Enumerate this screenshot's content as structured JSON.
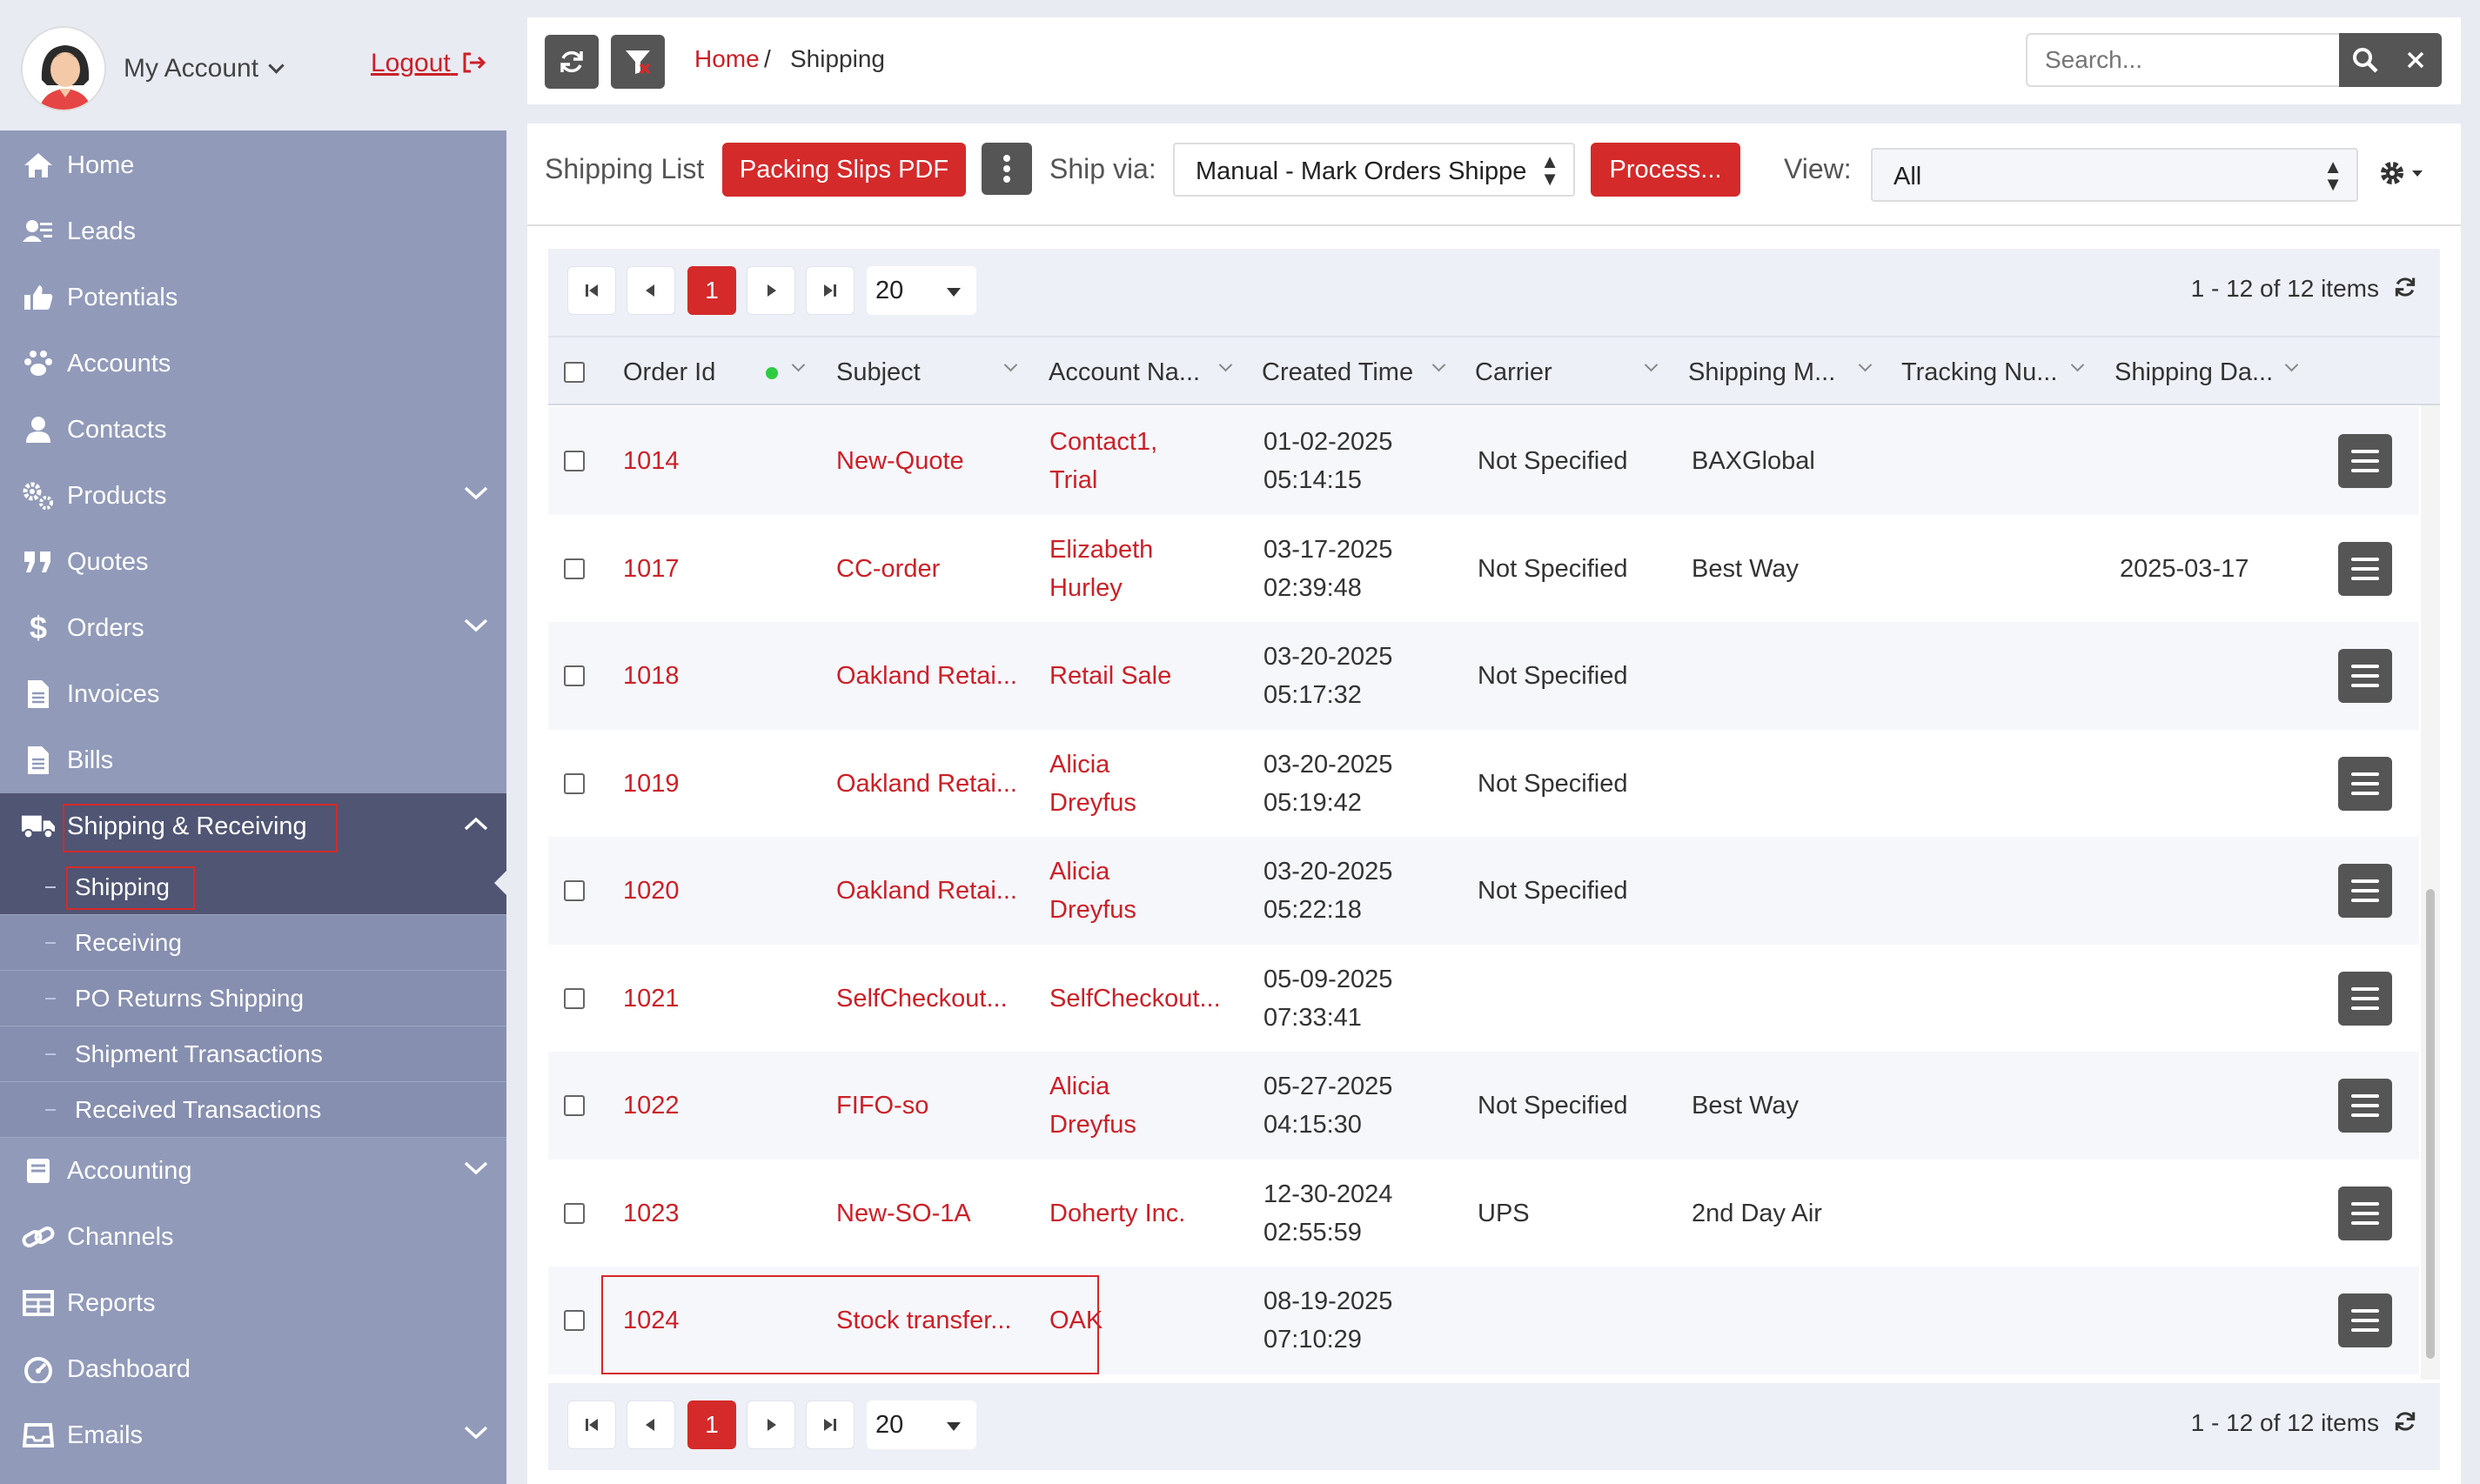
{
  "account": {
    "name": "My Account",
    "logout": "Logout"
  },
  "sidebar": {
    "items": [
      {
        "label": "Home",
        "icon": "home-icon"
      },
      {
        "label": "Leads",
        "icon": "leads-icon"
      },
      {
        "label": "Potentials",
        "icon": "thumbs-up-icon"
      },
      {
        "label": "Accounts",
        "icon": "paw-icon"
      },
      {
        "label": "Contacts",
        "icon": "user-icon"
      },
      {
        "label": "Products",
        "icon": "gears-icon"
      },
      {
        "label": "Quotes",
        "icon": "quote-icon"
      },
      {
        "label": "Orders",
        "icon": "dollar-icon"
      },
      {
        "label": "Invoices",
        "icon": "document-icon"
      },
      {
        "label": "Bills",
        "icon": "document-icon"
      },
      {
        "label": "Shipping & Receiving",
        "icon": "truck-icon"
      },
      {
        "label": "Accounting",
        "icon": "ledger-icon"
      },
      {
        "label": "Channels",
        "icon": "link-icon"
      },
      {
        "label": "Reports",
        "icon": "table-icon"
      },
      {
        "label": "Dashboard",
        "icon": "dashboard-icon"
      },
      {
        "label": "Emails",
        "icon": "inbox-icon"
      }
    ],
    "sub_items": [
      {
        "label": "Shipping"
      },
      {
        "label": "Receiving"
      },
      {
        "label": "PO Returns Shipping"
      },
      {
        "label": "Shipment Transactions"
      },
      {
        "label": "Received Transactions"
      }
    ]
  },
  "breadcrumb": {
    "home": "Home",
    "separator": "/",
    "current": "Shipping"
  },
  "search": {
    "placeholder": "Search..."
  },
  "listbar": {
    "title": "Shipping List",
    "packing_slips": "Packing Slips PDF",
    "ship_via_label": "Ship via:",
    "ship_via_value": "Manual - Mark Orders Shippe",
    "process": "Process...",
    "view_label": "View:",
    "view_value": "All"
  },
  "pager": {
    "current_page": "1",
    "page_size": "20",
    "info": "1 - 12 of 12 items"
  },
  "columns": [
    "Order Id",
    "Subject",
    "Account Na...",
    "Created Time",
    "Carrier",
    "Shipping M...",
    "Tracking Nu...",
    "Shipping Da..."
  ],
  "rows": [
    {
      "order_id": "1014",
      "subject": "New-Quote",
      "account": [
        "Contact1,",
        "Trial"
      ],
      "created": [
        "01-02-2025",
        "05:14:15"
      ],
      "carrier": "Not Specified",
      "method": "BAXGlobal",
      "tracking": "",
      "ship_date": ""
    },
    {
      "order_id": "1017",
      "subject": "CC-order",
      "account": [
        "Elizabeth",
        "Hurley"
      ],
      "created": [
        "03-17-2025",
        "02:39:48"
      ],
      "carrier": "Not Specified",
      "method": "Best Way",
      "tracking": "",
      "ship_date": "2025-03-17"
    },
    {
      "order_id": "1018",
      "subject": "Oakland Retai...",
      "account": [
        "Retail Sale",
        ""
      ],
      "created": [
        "03-20-2025",
        "05:17:32"
      ],
      "carrier": "Not Specified",
      "method": "",
      "tracking": "",
      "ship_date": ""
    },
    {
      "order_id": "1019",
      "subject": "Oakland Retai...",
      "account": [
        "Alicia",
        "Dreyfus"
      ],
      "created": [
        "03-20-2025",
        "05:19:42"
      ],
      "carrier": "Not Specified",
      "method": "",
      "tracking": "",
      "ship_date": ""
    },
    {
      "order_id": "1020",
      "subject": "Oakland Retai...",
      "account": [
        "Alicia",
        "Dreyfus"
      ],
      "created": [
        "03-20-2025",
        "05:22:18"
      ],
      "carrier": "Not Specified",
      "method": "",
      "tracking": "",
      "ship_date": ""
    },
    {
      "order_id": "1021",
      "subject": "SelfCheckout...",
      "account": [
        "SelfCheckout...",
        ""
      ],
      "created": [
        "05-09-2025",
        "07:33:41"
      ],
      "carrier": "",
      "method": "",
      "tracking": "",
      "ship_date": ""
    },
    {
      "order_id": "1022",
      "subject": "FIFO-so",
      "account": [
        "Alicia",
        "Dreyfus"
      ],
      "created": [
        "05-27-2025",
        "04:15:30"
      ],
      "carrier": "Not Specified",
      "method": "Best Way",
      "tracking": "",
      "ship_date": ""
    },
    {
      "order_id": "1023",
      "subject": "New-SO-1A",
      "account": [
        "Doherty Inc.",
        ""
      ],
      "created": [
        "12-30-2024",
        "02:55:59"
      ],
      "carrier": "UPS",
      "method": "2nd Day Air",
      "tracking": "",
      "ship_date": ""
    },
    {
      "order_id": "1024",
      "subject": "Stock transfer...",
      "account": [
        "OAK",
        ""
      ],
      "created": [
        "08-19-2025",
        "07:10:29"
      ],
      "carrier": "",
      "method": "",
      "tracking": "",
      "ship_date": ""
    }
  ],
  "colors": {
    "accent": "#cc2027",
    "sidebar": "#919ab9",
    "sidebar_active": "#4f5573",
    "dark_button": "#555555",
    "status_dot": "#2ecc40"
  }
}
